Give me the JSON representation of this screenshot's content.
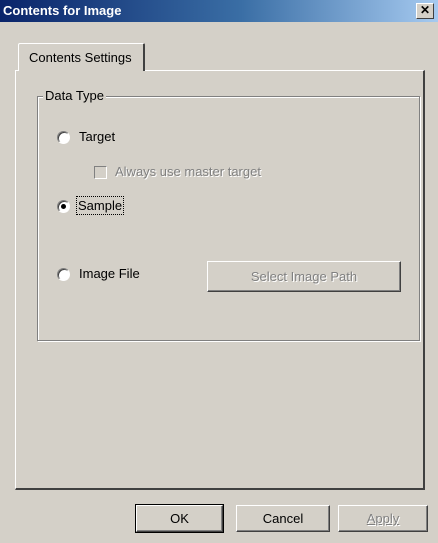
{
  "window": {
    "title": "Contents for Image",
    "close_glyph": "✕"
  },
  "tabs": [
    {
      "label": "Contents Settings",
      "selected": true
    }
  ],
  "group": {
    "legend": "Data Type"
  },
  "options": {
    "target_label": "Target",
    "always_master_label": "Always use master target",
    "sample_label": "Sample",
    "image_file_label": "Image File",
    "select_path_label": "Select Image Path",
    "selected": "Sample"
  },
  "buttons": {
    "ok": "OK",
    "cancel": "Cancel",
    "apply": "Apply"
  }
}
